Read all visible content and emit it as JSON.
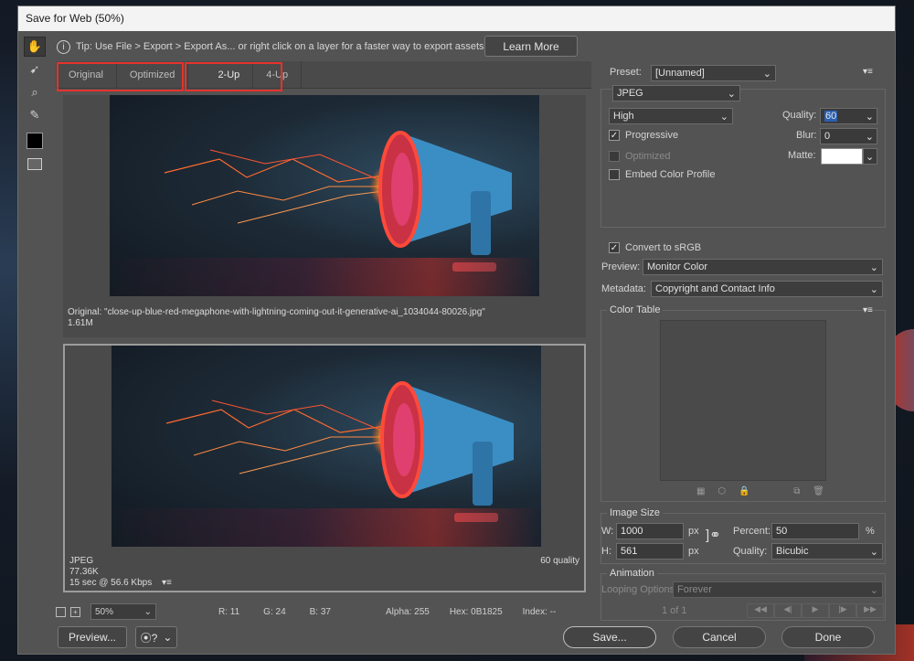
{
  "window": {
    "title": "Save for Web (50%)"
  },
  "tools": [
    {
      "name": "hand-tool-icon",
      "glyph": "✋"
    },
    {
      "name": "slice-select-tool-icon",
      "glyph": "⤡"
    },
    {
      "name": "zoom-tool-icon",
      "glyph": "🔍"
    },
    {
      "name": "eyedropper-tool-icon",
      "glyph": "✎"
    }
  ],
  "tip": {
    "text": "Tip: Use File > Export > Export As...  or right click on a layer for a faster way to export assets",
    "button": "Learn More"
  },
  "tabs": [
    "Original",
    "Optimized",
    "2-Up",
    "4-Up"
  ],
  "original_pane": {
    "caption": "Original: \"close-up-blue-red-megaphone-with-lightning-coming-out-it-generative-ai_1034044-80026.jpg\"",
    "size": "1.61M"
  },
  "optimized_pane": {
    "format": "JPEG",
    "size": "77.36K",
    "time": "15 sec @ 56.6 Kbps",
    "quality": "60 quality"
  },
  "status": {
    "zoom": "50%",
    "r": "R: 11",
    "g": "G: 24",
    "b": "B: 37",
    "alpha": "Alpha: 255",
    "hex": "Hex: 0B1825",
    "index": "Index: --"
  },
  "bottom": {
    "preview": "Preview...",
    "save": "Save...",
    "cancel": "Cancel",
    "done": "Done"
  },
  "settings": {
    "preset_label": "Preset:",
    "preset_value": "[Unnamed]",
    "format": "JPEG",
    "compression": "High",
    "quality_label": "Quality:",
    "quality_value": "60",
    "progressive": "Progressive",
    "blur_label": "Blur:",
    "blur_value": "0",
    "optimized": "Optimized",
    "matte_label": "Matte:",
    "embed": "Embed Color Profile",
    "convert": "Convert to sRGB",
    "preview_label": "Preview:",
    "preview_value": "Monitor Color",
    "metadata_label": "Metadata:",
    "metadata_value": "Copyright and Contact Info"
  },
  "color_table": {
    "title": "Color Table"
  },
  "image_size": {
    "title": "Image Size",
    "w_label": "W:",
    "w_value": "1000",
    "h_label": "H:",
    "h_value": "561",
    "unit": "px",
    "percent_label": "Percent:",
    "percent_value": "50",
    "percent_unit": "%",
    "quality_label": "Quality:",
    "quality_value": "Bicubic"
  },
  "animation": {
    "title": "Animation",
    "looping_label": "Looping Options:",
    "looping_value": "Forever",
    "frame": "1 of 1"
  }
}
